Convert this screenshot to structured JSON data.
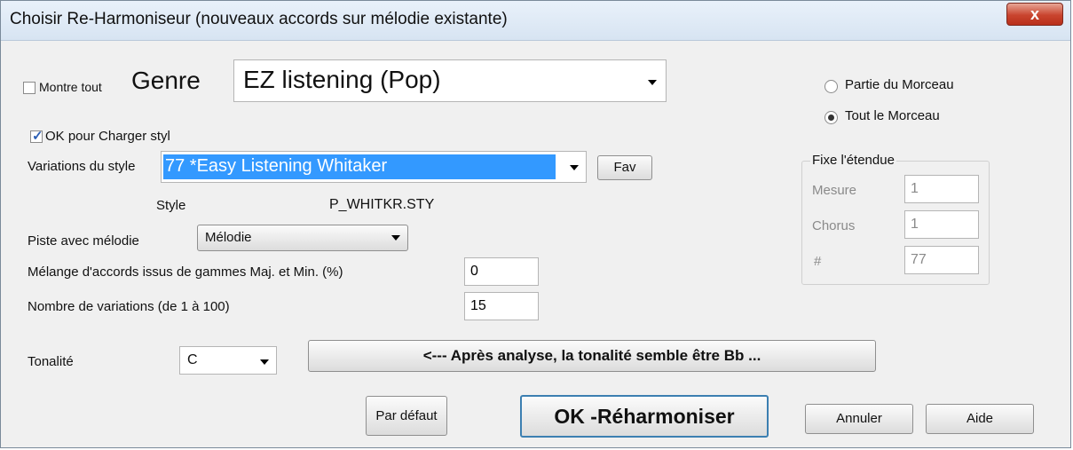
{
  "window": {
    "title": "Choisir Re-Harmoniseur (nouveaux accords sur mélodie existante)",
    "close_label": "x"
  },
  "show_all": {
    "label": "Montre tout",
    "checked": false
  },
  "genre": {
    "label": "Genre",
    "value": "EZ listening (Pop)"
  },
  "range_radio": {
    "part_label": "Partie du Morceau",
    "whole_label": "Tout le Morceau",
    "selected": "whole"
  },
  "load_style": {
    "label": "OK pour Charger styl",
    "checked": true
  },
  "style_variations": {
    "label": "Variations du style",
    "value": "77 *Easy Listening Whitaker",
    "fav_label": "Fav"
  },
  "style": {
    "label": "Style",
    "file": "P_WHITKR.STY"
  },
  "extent": {
    "title": "Fixe l'étendue",
    "measure_label": "Mesure",
    "measure_value": "1",
    "chorus_label": "Chorus",
    "chorus_value": "1",
    "hash_label": "#",
    "hash_value": "77"
  },
  "melody_track": {
    "label": "Piste avec mélodie",
    "value": "Mélodie"
  },
  "mix": {
    "label": "Mélange d'accords issus de gammes Maj. et Min. (%)",
    "value": "0"
  },
  "variations_count": {
    "label": "Nombre de variations (de 1 à 100)",
    "value": "15"
  },
  "key": {
    "label": "Tonalité",
    "value": "C",
    "analysis_button": "<--- Après analyse, la tonalité semble être  Bb ..."
  },
  "buttons": {
    "default": "Par défaut",
    "ok": "OK -Réharmoniser",
    "cancel": "Annuler",
    "help": "Aide"
  }
}
